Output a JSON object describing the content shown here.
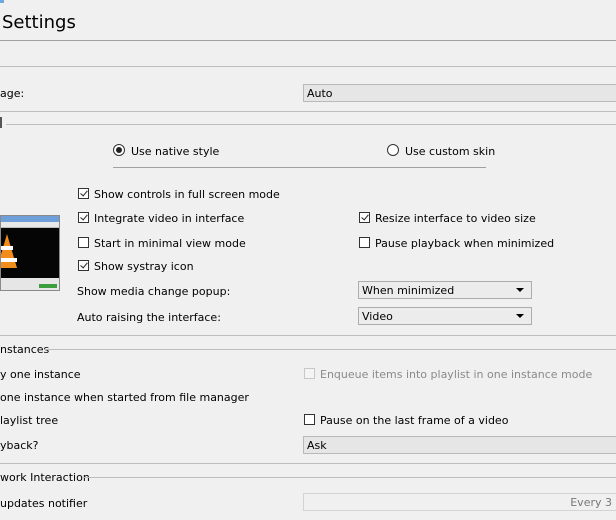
{
  "header": {
    "title": "Settings"
  },
  "general": {
    "language_label": "age:",
    "language_value": "Auto"
  },
  "look": {
    "native_style_label": "Use native style",
    "custom_skin_label": "Use custom skin",
    "fullscreen_controls_label": "Show controls in full screen mode",
    "integrate_video_label": "Integrate video in interface",
    "resize_interface_label": "Resize interface to video size",
    "minimal_view_label": "Start in minimal view mode",
    "pause_minimized_label": "Pause playback when minimized",
    "systray_label": "Show systray icon",
    "media_popup_label": "Show media change popup:",
    "media_popup_value": "When minimized",
    "auto_raise_label": "Auto raising the interface:",
    "auto_raise_value": "Video"
  },
  "instances": {
    "section_title": "nstances",
    "one_instance_label": "y one instance",
    "enqueue_label": "Enqueue items into playlist in one instance mode",
    "file_manager_label": "one instance when started from file manager",
    "playlist_tree_label": "laylist tree",
    "pause_last_frame_label": "Pause on the last frame of a video",
    "playback_label": "yback?",
    "playback_value": "Ask"
  },
  "network": {
    "section_title": "work Interaction",
    "updates_label": "updates notifier",
    "updates_value": "Every 3"
  }
}
